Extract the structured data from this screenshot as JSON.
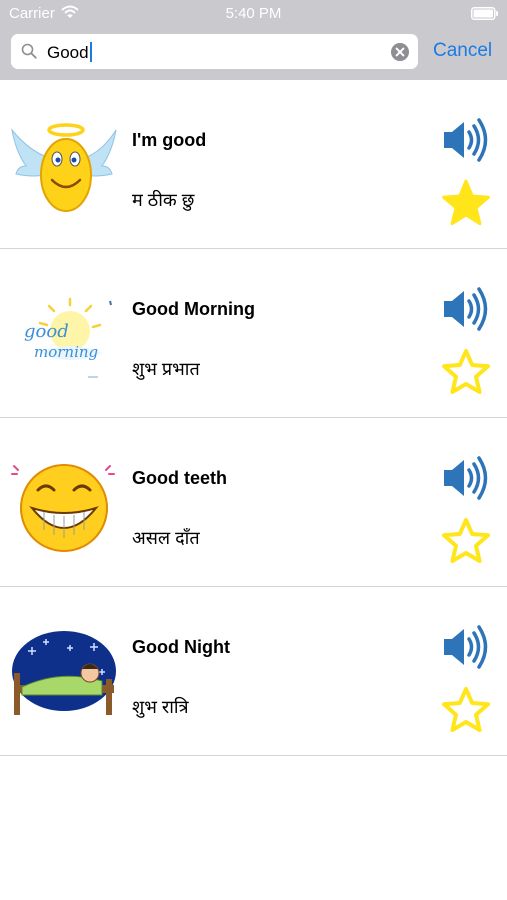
{
  "status_bar": {
    "carrier": "Carrier",
    "time": "5:40 PM",
    "icons": [
      "wifi-icon",
      "battery-icon"
    ]
  },
  "search": {
    "query": "Good",
    "icons": [
      "search-icon",
      "clear-icon"
    ]
  },
  "cancel_label": "Cancel",
  "colors": {
    "accent": "#1b7be3",
    "star": "#ffe51a",
    "speaker": "#2d74b8",
    "divider": "#d4d4d4"
  },
  "results": [
    {
      "english": "I'm good",
      "nepali": "म ठीक छु",
      "image": "angel-smiley",
      "favorite": true
    },
    {
      "english": "Good Morning",
      "nepali": "शुभ प्रभात",
      "image": "good-morning-sun",
      "favorite": false
    },
    {
      "english": "Good teeth",
      "nepali": "असल दाँत",
      "image": "grinning-smiley",
      "favorite": false
    },
    {
      "english": "Good Night",
      "nepali": "शुभ रात्रि",
      "image": "sleeping-child",
      "favorite": false
    }
  ]
}
